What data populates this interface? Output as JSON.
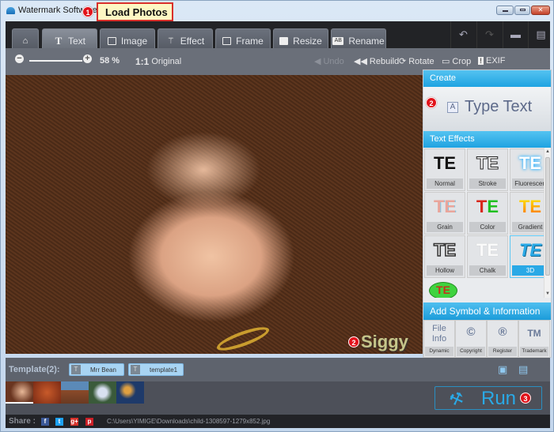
{
  "window": {
    "title": "Watermark Software",
    "controls": [
      "minimize",
      "maximize",
      "close"
    ]
  },
  "callout": {
    "badge": "1",
    "label": "Load Photos"
  },
  "tabs": [
    {
      "id": "home",
      "label": "",
      "icon": "home-icon"
    },
    {
      "id": "text",
      "label": "Text",
      "icon": "text-icon",
      "active": true
    },
    {
      "id": "image",
      "label": "Image",
      "icon": "image-icon"
    },
    {
      "id": "effect",
      "label": "Effect",
      "icon": "magic-wand-icon"
    },
    {
      "id": "frame",
      "label": "Frame",
      "icon": "frame-icon"
    },
    {
      "id": "resize",
      "label": "Resize",
      "icon": "resize-icon"
    },
    {
      "id": "rename",
      "label": "Rename",
      "icon": "rename-icon"
    }
  ],
  "right_tools": [
    "undo-icon",
    "redo-icon",
    "feedback-icon",
    "export-icon"
  ],
  "subtoolbar": {
    "zoom_percent": "58 %",
    "original_label": "Original",
    "one_to_one": "1:1",
    "undo": "Undo",
    "rebuild": "Rebuild",
    "rotate": "Rotate",
    "crop": "Crop",
    "exif": "EXIF"
  },
  "canvas": {
    "watermark_text": "Siggy",
    "watermark_badge": "2"
  },
  "panel": {
    "create_header": "Create",
    "create_badge": "2",
    "type_text": "Type Text",
    "type_text_icon": "A",
    "effects_header": "Text Effects",
    "effect_glyph": "TE",
    "effects": [
      "Normal",
      "Stroke",
      "Fluorescen",
      "Grain",
      "Color",
      "Gradient",
      "Hollow",
      "Chalk",
      "3D",
      ""
    ],
    "selected_effect": "3D",
    "symbol_header": "Add Symbol & Information",
    "symbols": [
      {
        "glyph": "File Info",
        "label": "Dynamic"
      },
      {
        "glyph": "©",
        "label": "Copyright"
      },
      {
        "glyph": "®",
        "label": "Register"
      },
      {
        "glyph": "TM",
        "label": "Trademark"
      }
    ]
  },
  "templates": {
    "label": "Template(2):",
    "items": [
      "Mrr Bean",
      "template1"
    ]
  },
  "run": {
    "label": "Run",
    "badge": "3"
  },
  "share": {
    "label": "Share :",
    "networks": [
      "facebook",
      "twitter",
      "google-plus",
      "pinterest"
    ],
    "file_path": "C:\\Users\\YIMIGE\\Downloads\\child-1308597-1279x852.jpg"
  },
  "thumbnails": [
    "baby-hand",
    "red-flower",
    "desert-rock",
    "hydrangea",
    "jellyfish"
  ]
}
